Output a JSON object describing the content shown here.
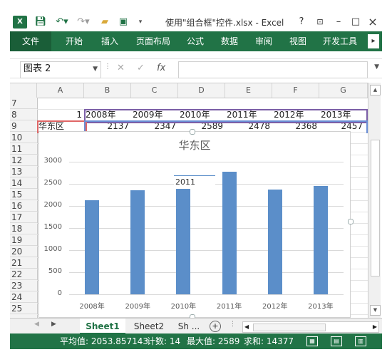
{
  "titlebar": {
    "logo": "X",
    "save_icon": "save-icon",
    "undo": "undo-icon",
    "redo": "redo-icon",
    "title": "使用\"组合框\"控件.xlsx - Excel",
    "help": "?",
    "restore_ribbon": "ribbon-display-icon",
    "minimize": "–",
    "maximize": "□",
    "close": "×"
  },
  "ribbon": {
    "tabs": [
      "文件",
      "开始",
      "插入",
      "页面布局",
      "公式",
      "数据",
      "审阅",
      "视图",
      "开发工具"
    ],
    "scroll": "▸"
  },
  "formula_bar": {
    "name_box": "图表 2",
    "fx": "fx",
    "value": ""
  },
  "sheet": {
    "columns": [
      "A",
      "B",
      "C",
      "D",
      "E",
      "F",
      "G"
    ],
    "rows": [
      "7",
      "8",
      "9",
      "10",
      "11",
      "12",
      "13",
      "14",
      "15",
      "16",
      "17",
      "18",
      "19",
      "20",
      "21",
      "22",
      "23",
      "24",
      "25"
    ],
    "row8": {
      "a": "1",
      "values": [
        "2008年",
        "2009年",
        "2010年",
        "2011年",
        "2012年",
        "2013年"
      ]
    },
    "row9": {
      "a": "华东区",
      "values": [
        "2137",
        "2347",
        "2589",
        "2478",
        "2368",
        "2457"
      ]
    }
  },
  "chart_data": {
    "type": "bar",
    "title": "华东区",
    "categories": [
      "2008年",
      "2009年",
      "2010年",
      "2011年",
      "2012年",
      "2013年"
    ],
    "values": [
      2137,
      2347,
      2589,
      2778,
      2368,
      2457
    ],
    "ylim": [
      0,
      3000
    ],
    "yticks": [
      0,
      500,
      1000,
      1500,
      2000,
      2500,
      3000
    ],
    "overlay_label": "2011",
    "colors": {
      "bar": "#5b8ec9"
    },
    "grid": true
  },
  "sheet_tabs": {
    "tabs": [
      "Sheet1",
      "Sheet2",
      "Sh ..."
    ],
    "active": "Sheet1",
    "add": "+"
  },
  "status": {
    "average": "平均值: 2053.857143",
    "count": "计数: 14",
    "max": "最大值: 2589",
    "sum": "求和: 14377"
  },
  "theme": {
    "accent": "#217346"
  }
}
